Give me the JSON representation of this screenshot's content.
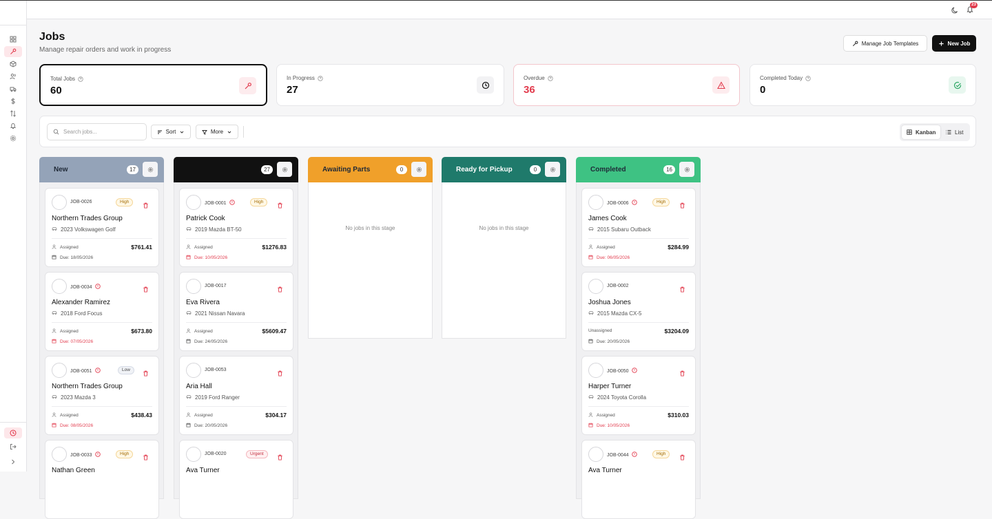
{
  "app": {
    "colors": {
      "accent": "#e23b4d",
      "dark": "#111111"
    }
  },
  "topbar": {
    "notification_count": "23",
    "icons": [
      "moon-icon",
      "bell-icon"
    ]
  },
  "sidebar": {
    "items": [
      "dashboard-icon",
      "wrench-icon",
      "package-icon",
      "users-icon",
      "truck-icon",
      "dollar-icon",
      "transfer-icon",
      "bell-icon",
      "settings-icon"
    ],
    "bottom": [
      "clock-icon",
      "logout-icon",
      "chevron-right-icon"
    ]
  },
  "header": {
    "title": "Jobs",
    "subtitle": "Manage repair orders and work in progress",
    "templates_label": "Manage Job Templates",
    "new_label": "New Job"
  },
  "stats": [
    {
      "label": "Total Jobs",
      "value": "60",
      "icon": "wrench-icon"
    },
    {
      "label": "In Progress",
      "value": "27",
      "icon": "clock-icon"
    },
    {
      "label": "Overdue",
      "value": "36",
      "icon": "alert-triangle-icon"
    },
    {
      "label": "Completed Today",
      "value": "0",
      "icon": "check-circle-icon"
    }
  ],
  "toolbar": {
    "search_placeholder": "Search jobs...",
    "sort_label": "Sort",
    "more_label": "More",
    "kanban_label": "Kanban",
    "list_label": "List"
  },
  "columns": [
    {
      "title": "New",
      "count": "17",
      "color": "#94a3b8",
      "text": "#1f2937",
      "cards": [
        {
          "id": "JOB-0026",
          "overdue": false,
          "priority": "High",
          "customer": "Northern Trades Group",
          "vehicle": "2023 Volkswagen Golf",
          "assigned": "Assigned",
          "price": "$761.41",
          "due": "Due: 18/05/2026",
          "due_over": false
        },
        {
          "id": "JOB-0034",
          "overdue": true,
          "priority": "",
          "customer": "Alexander Ramirez",
          "vehicle": "2018 Ford Focus",
          "assigned": "Assigned",
          "price": "$673.80",
          "due": "Due: 07/05/2026",
          "due_over": true
        },
        {
          "id": "JOB-0051",
          "overdue": true,
          "priority": "Low",
          "customer": "Northern Trades Group",
          "vehicle": "2023 Mazda 3",
          "assigned": "Assigned",
          "price": "$438.43",
          "due": "Due: 08/05/2026",
          "due_over": true
        },
        {
          "id": "JOB-0033",
          "overdue": true,
          "priority": "High",
          "customer": "Nathan Green",
          "vehicle": "",
          "assigned": "",
          "price": "",
          "due": "",
          "due_over": false
        }
      ]
    },
    {
      "title": "",
      "count": "27",
      "color": "#111111",
      "text": "#ffffff",
      "cards": [
        {
          "id": "JOB-0001",
          "overdue": true,
          "priority": "High",
          "customer": "Patrick Cook",
          "vehicle": "2019 Mazda BT-50",
          "assigned": "Assigned",
          "price": "$1276.83",
          "due": "Due: 10/05/2026",
          "due_over": true
        },
        {
          "id": "JOB-0017",
          "overdue": false,
          "priority": "",
          "customer": "Eva Rivera",
          "vehicle": "2021 Nissan Navara",
          "assigned": "Assigned",
          "price": "$5609.47",
          "due": "Due: 24/05/2026",
          "due_over": false
        },
        {
          "id": "JOB-0053",
          "overdue": false,
          "priority": "",
          "customer": "Aria Hall",
          "vehicle": "2019 Ford Ranger",
          "assigned": "Assigned",
          "price": "$304.17",
          "due": "Due: 20/05/2026",
          "due_over": false
        },
        {
          "id": "JOB-0020",
          "overdue": false,
          "priority": "Urgent",
          "customer": "Ava Turner",
          "vehicle": "",
          "assigned": "",
          "price": "",
          "due": "",
          "due_over": false
        }
      ]
    },
    {
      "title": "Awaiting Parts",
      "count": "0",
      "color": "#f0a02a",
      "text": "#1f2937",
      "empty": "No jobs in this stage",
      "cards": []
    },
    {
      "title": "Ready for Pickup",
      "count": "0",
      "color": "#1f7a6b",
      "text": "#ffffff",
      "empty": "No jobs in this stage",
      "cards": []
    },
    {
      "title": "Completed",
      "count": "16",
      "color": "#3ec283",
      "text": "#1f2937",
      "cards": [
        {
          "id": "JOB-0006",
          "overdue": true,
          "priority": "High",
          "customer": "James Cook",
          "vehicle": "2015 Subaru Outback",
          "assigned": "Assigned",
          "price": "$284.99",
          "due": "Due: 06/05/2026",
          "due_over": true
        },
        {
          "id": "JOB-0002",
          "overdue": false,
          "priority": "",
          "customer": "Joshua Jones",
          "vehicle": "2015 Mazda CX-5",
          "assigned": "Unassigned",
          "price": "$3204.09",
          "due": "Due: 20/05/2026",
          "due_over": false
        },
        {
          "id": "JOB-0050",
          "overdue": true,
          "priority": "",
          "customer": "Harper Turner",
          "vehicle": "2024 Toyota Corolla",
          "assigned": "Assigned",
          "price": "$310.03",
          "due": "Due: 10/05/2026",
          "due_over": true
        },
        {
          "id": "JOB-0044",
          "overdue": true,
          "priority": "High",
          "customer": "Ava Turner",
          "vehicle": "",
          "assigned": "",
          "price": "",
          "due": "",
          "due_over": false
        }
      ]
    }
  ]
}
